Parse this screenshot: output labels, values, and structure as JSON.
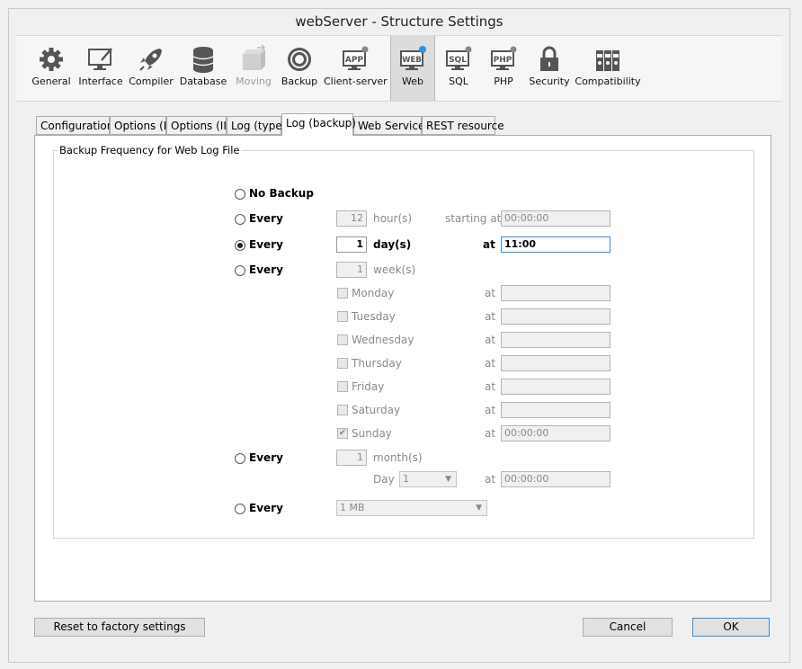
{
  "window": {
    "title": "webServer - Structure Settings"
  },
  "toolbar": {
    "items": [
      {
        "label": "General"
      },
      {
        "label": "Interface"
      },
      {
        "label": "Compiler"
      },
      {
        "label": "Database"
      },
      {
        "label": "Moving"
      },
      {
        "label": "Backup"
      },
      {
        "label": "Client-server"
      },
      {
        "label": "Web"
      },
      {
        "label": "SQL"
      },
      {
        "label": "PHP"
      },
      {
        "label": "Security"
      },
      {
        "label": "Compatibility"
      }
    ],
    "icon_text": {
      "client": "APP",
      "web": "WEB",
      "sql": "SQL",
      "php": "PHP"
    }
  },
  "tabs": [
    "Configuration",
    "Options (I)",
    "Options (II)",
    "Log (type)",
    "Log (backup)",
    "Web Services",
    "REST resource"
  ],
  "group": {
    "title": "Backup Frequency for Web Log File",
    "no_backup": {
      "label": "No Backup",
      "selected": false
    },
    "hours": {
      "label": "Every",
      "value": "12",
      "unit": "hour(s)",
      "starting_label": "starting at",
      "time": "00:00:00",
      "selected": false
    },
    "days": {
      "label": "Every",
      "value": "1",
      "unit": "day(s)",
      "at_label": "at",
      "time": "11:00",
      "selected": true
    },
    "weeks": {
      "label": "Every",
      "value": "1",
      "unit": "week(s)",
      "selected": false,
      "days": [
        {
          "name": "Monday",
          "at": "at",
          "time": "",
          "checked": false
        },
        {
          "name": "Tuesday",
          "at": "at",
          "time": "",
          "checked": false
        },
        {
          "name": "Wednesday",
          "at": "at",
          "time": "",
          "checked": false
        },
        {
          "name": "Thursday",
          "at": "at",
          "time": "",
          "checked": false
        },
        {
          "name": "Friday",
          "at": "at",
          "time": "",
          "checked": false
        },
        {
          "name": "Saturday",
          "at": "at",
          "time": "",
          "checked": false
        },
        {
          "name": "Sunday",
          "at": "at",
          "time": "00:00:00",
          "checked": true
        }
      ]
    },
    "months": {
      "label": "Every",
      "value": "1",
      "unit": "month(s)",
      "day_label": "Day",
      "day_value": "1",
      "at_label": "at",
      "time": "00:00:00",
      "selected": false
    },
    "size": {
      "label": "Every",
      "value": "1 MB",
      "selected": false
    }
  },
  "buttons": {
    "reset": "Reset to factory settings",
    "cancel": "Cancel",
    "ok": "OK"
  },
  "colors": {
    "focus_border": "#3c8fd6",
    "web_star": "#2f8fe0"
  }
}
